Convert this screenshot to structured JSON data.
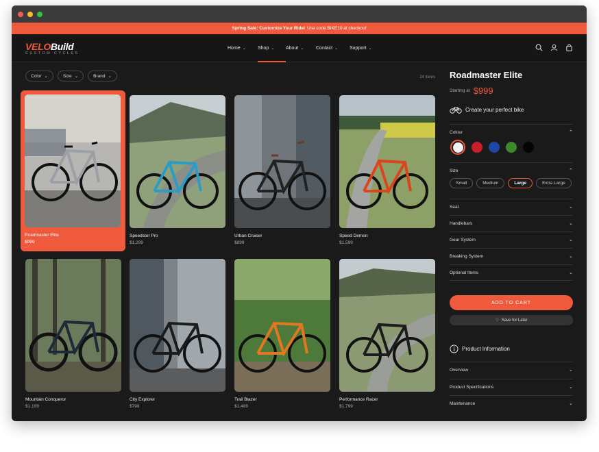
{
  "promo": {
    "bold": "Spring Sale: Customize Your Ride!",
    "rest": "Use code BIKE10 at checkout"
  },
  "logo": {
    "main_a": "VELO",
    "main_b": "Build",
    "sub": "CUSTOM CYCLES"
  },
  "nav": [
    {
      "label": "Home"
    },
    {
      "label": "Shop"
    },
    {
      "label": "About"
    },
    {
      "label": "Contact"
    },
    {
      "label": "Support"
    }
  ],
  "filters": [
    {
      "label": "Color"
    },
    {
      "label": "Size"
    },
    {
      "label": "Brand"
    }
  ],
  "item_count": "24 items",
  "products": [
    {
      "name": "Roadmaster Elite",
      "price": "$999"
    },
    {
      "name": "Speedster Pro",
      "price": "$1,299"
    },
    {
      "name": "Urban Cruiser",
      "price": "$899"
    },
    {
      "name": "Speed Demon",
      "price": "$1,599"
    },
    {
      "name": "Mountain Conqueror",
      "price": "$1,199"
    },
    {
      "name": "City Explorer",
      "price": "$799"
    },
    {
      "name": "Trail Blazer",
      "price": "$1,499"
    },
    {
      "name": "Performance Racer",
      "price": "$1,799"
    }
  ],
  "panel": {
    "title": "Roadmaster Elite",
    "starting_label": "Starting at",
    "price": "$999",
    "create_label": "Create your perfect bike",
    "colour_label": "Colour",
    "colours": [
      "#f2f2f2",
      "#c8202a",
      "#1c46a8",
      "#3e8a2a",
      "#050505"
    ],
    "size_label": "Size",
    "sizes": [
      {
        "label": "Small"
      },
      {
        "label": "Medium"
      },
      {
        "label": "Large"
      },
      {
        "label": "Extra Large"
      }
    ],
    "options": [
      {
        "label": "Seat"
      },
      {
        "label": "Handlebars"
      },
      {
        "label": "Gear System"
      },
      {
        "label": "Breaking System"
      },
      {
        "label": "Optional Items"
      }
    ],
    "add_to_cart": "ADD TO CART",
    "save_later": "Save for Later",
    "product_info_label": "Product Information",
    "info_sections": [
      {
        "label": "Overview"
      },
      {
        "label": "Product Specifications"
      },
      {
        "label": "Maintenance"
      }
    ]
  },
  "colors": {
    "accent": "#f05a3c",
    "background": "#1a1a1a"
  }
}
